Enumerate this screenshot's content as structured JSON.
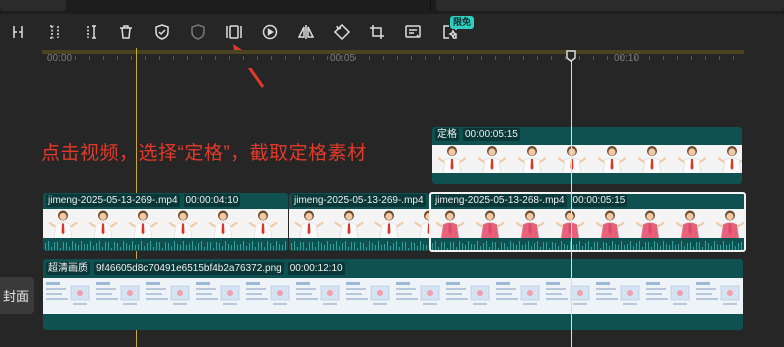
{
  "toolbar": {
    "tools": [
      {
        "name": "split-icon"
      },
      {
        "name": "split-left-icon"
      },
      {
        "name": "split-right-icon"
      },
      {
        "name": "delete-icon"
      },
      {
        "name": "shield-check-icon"
      },
      {
        "name": "shield-icon"
      },
      {
        "name": "freeze-frame-icon"
      },
      {
        "name": "play-circle-icon"
      },
      {
        "name": "mirror-icon"
      },
      {
        "name": "rotate-icon"
      },
      {
        "name": "crop-icon"
      },
      {
        "name": "caption-icon"
      },
      {
        "name": "smart-cut-icon"
      }
    ],
    "badge": "限免"
  },
  "ruler": {
    "labels": [
      "00:00",
      "00:05",
      "00:10"
    ]
  },
  "annotation": {
    "text": "点击视频，选择“定格”，截取定格素材"
  },
  "tracks": {
    "freeze_clip": {
      "label": "定格",
      "duration": "00:00:05:15"
    },
    "video_clips": [
      {
        "name": "jimeng-2025-05-13-269-.mp4",
        "duration": "00:00:04:10"
      },
      {
        "name": "jimeng-2025-05-13-269-.mp4",
        "duration": ""
      },
      {
        "name": "jimeng-2025-05-13-268-.mp4",
        "duration": "00:00:05:15"
      }
    ],
    "image_clip": {
      "quality": "超清画质",
      "name": "9f46605d8c70491e6515bf4b2a76372.png",
      "duration": "00:00:12:10"
    }
  },
  "cover": {
    "label": "封面"
  },
  "colors": {
    "clip": "#0f5050",
    "accent": "#2fd0c0",
    "annotation": "#e23a2a",
    "playhead": "#dcdcdc"
  }
}
